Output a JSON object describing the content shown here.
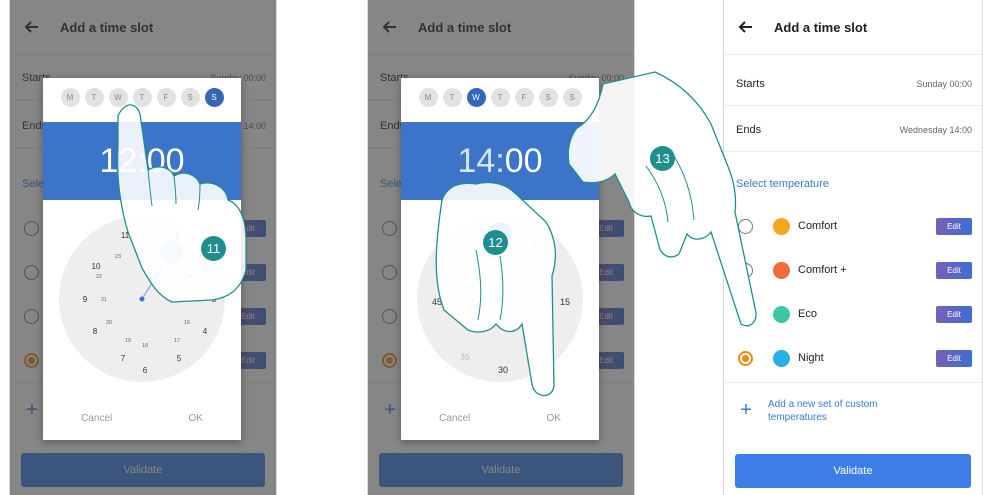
{
  "header": {
    "title": "Add a time slot"
  },
  "slot": {
    "starts_label": "Starts",
    "starts_value": "Sunday 00:00",
    "ends_label": "Ends",
    "ends_value": "Wednesday 14:00"
  },
  "section": {
    "select_temperature": "Select temperature"
  },
  "temperatures": [
    {
      "label": "Comfort",
      "color": "#f5a623",
      "selected": false
    },
    {
      "label": "Comfort +",
      "color": "#f26b3a",
      "selected": false
    },
    {
      "label": "Eco",
      "color": "#3cc7a2",
      "selected": false
    },
    {
      "label": "Night",
      "color": "#2aaee6",
      "selected": true
    }
  ],
  "edit_label": "Edit",
  "add_custom": "Add a new set of custom temperatures",
  "validate_label": "Validate",
  "dialog1": {
    "days": [
      "M",
      "T",
      "W",
      "T",
      "F",
      "S",
      "S"
    ],
    "selected_day_index": 6,
    "time": "12:00",
    "outer_hours": [
      "11",
      "1",
      "10",
      "2",
      "9",
      "3",
      "8",
      "4",
      "7",
      "5",
      "6"
    ],
    "inner_hours": [
      "23",
      "12",
      "22",
      "14",
      "21",
      "15",
      "20",
      "16",
      "19",
      "17",
      "18"
    ],
    "cancel": "Cancel",
    "ok": "OK"
  },
  "dialog2": {
    "days": [
      "M",
      "T",
      "W",
      "T",
      "F",
      "S",
      "S"
    ],
    "selected_day_index": 2,
    "time_hour": "14",
    "time_sep": ":",
    "time_min": "00",
    "minutes": [
      "55",
      "05",
      "45",
      "15",
      "35",
      "30"
    ],
    "cancel": "Cancel",
    "ok": "OK"
  },
  "steps": [
    "11",
    "12",
    "13"
  ],
  "icons": {
    "back": "arrow-left-icon",
    "plus": "plus-icon",
    "comfort": "sun-icon",
    "comfort_plus": "flame-icon",
    "eco": "leaf-icon",
    "night": "moon-icon"
  }
}
